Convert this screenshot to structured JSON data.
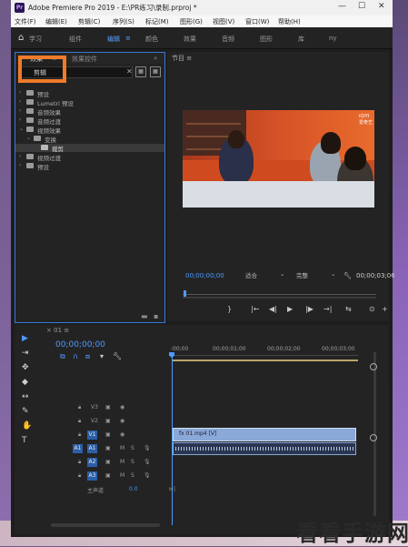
{
  "window": {
    "title": "Adobe Premiere Pro 2019 - E:\\PR练习\\录制.prproj *",
    "logo": "Pr",
    "controls": {
      "minimize": "—",
      "maximize": "☐",
      "close": "✕"
    }
  },
  "menu": [
    "文件(F)",
    "编辑(E)",
    "剪辑(C)",
    "序列(S)",
    "标记(M)",
    "图形(G)",
    "视图(V)",
    "窗口(W)",
    "帮助(H)"
  ],
  "workspaces": {
    "items": [
      "学习",
      "组件",
      "编辑",
      "颜色",
      "效果",
      "音频",
      "图形",
      "库",
      "ny"
    ],
    "active": "编辑",
    "menu_icon": "≡"
  },
  "effects_panel": {
    "tabs": [
      "效果",
      "≡",
      "效果控件"
    ],
    "expand": "»",
    "search_value": "剪辑",
    "tree": [
      {
        "label": "预设",
        "level": 0
      },
      {
        "label": "Lumetri 预设",
        "level": 0
      },
      {
        "label": "音频效果",
        "level": 0
      },
      {
        "label": "音频过渡",
        "level": 0
      },
      {
        "label": "视频效果",
        "level": 0,
        "open": true
      },
      {
        "label": "变换",
        "level": 1,
        "open": true
      },
      {
        "label": "裁剪",
        "level": 2,
        "selected": true
      },
      {
        "label": "视频过渡",
        "level": 0
      },
      {
        "label": "预设",
        "level": 0
      }
    ]
  },
  "program_monitor": {
    "title": "节目",
    "menu_icon": "≡",
    "watermark": "iQIYI 爱奇艺",
    "timecode_current": "00;00;00;00",
    "fit": "适合",
    "resolution": "完整",
    "timecode_duration": "00;00;03;06",
    "transport": [
      "{",
      "}",
      "|←",
      "◀|",
      "▶",
      "|▶",
      "→|",
      "⇆",
      "⊙",
      "+"
    ]
  },
  "timeline": {
    "tab": "01",
    "menu_icon": "≡",
    "timecode": "00;00;00;00",
    "ruler": [
      ":00;00",
      "00;00;01;00",
      "00;00;02;00",
      "00;00;03;00"
    ],
    "tracks": [
      {
        "name": "V3",
        "target": ""
      },
      {
        "name": "V2",
        "target": ""
      },
      {
        "name": "V1",
        "target": "V1"
      },
      {
        "name": "A1",
        "target": "A1"
      },
      {
        "name": "A2",
        "target": ""
      },
      {
        "name": "A3",
        "target": ""
      }
    ],
    "master": {
      "label": "主声道",
      "value": "0.0"
    },
    "clip_video": "fx 01.mp4 [V]",
    "clip_audio": "fx"
  },
  "tools": [
    "▶",
    "⇥",
    "✥",
    "◆",
    "↔",
    "✎",
    "✋",
    "T"
  ],
  "watermark_text": "看看手游网",
  "colors": {
    "accent": "#4d9bff",
    "highlight": "#f07b2a",
    "panel_bg": "#232323"
  }
}
